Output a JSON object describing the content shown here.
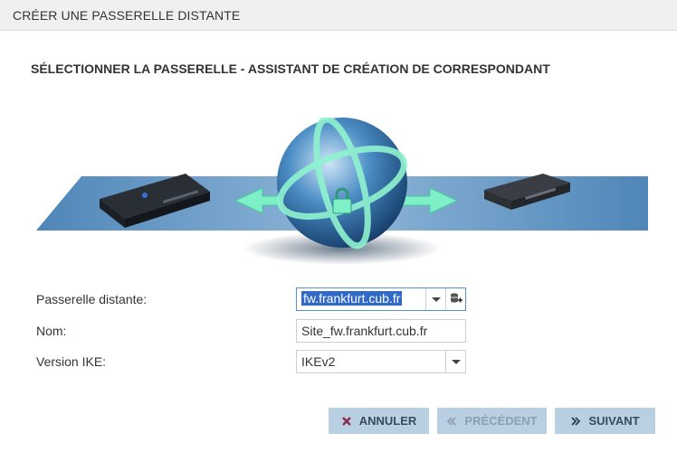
{
  "window": {
    "title": "CRÉER UNE PASSERELLE DISTANTE"
  },
  "wizard": {
    "heading": "SÉLECTIONNER LA PASSERELLE - ASSISTANT DE CRÉATION DE CORRESPONDANT"
  },
  "form": {
    "remote_gateway": {
      "label": "Passerelle distante:",
      "value": "fw.frankfurt.cub.fr"
    },
    "name": {
      "label": "Nom:",
      "value": "Site_fw.frankfurt.cub.fr"
    },
    "ike_version": {
      "label": "Version IKE:",
      "value": "IKEv2"
    }
  },
  "buttons": {
    "cancel": "ANNULER",
    "previous": "PRÉCÉDENT",
    "next": "SUIVANT"
  },
  "icons": {
    "cancel": "close-icon",
    "previous": "double-chevron-left-icon",
    "next": "double-chevron-right-icon",
    "database": "database-add-icon"
  },
  "colors": {
    "button_bg": "#b9cfe2",
    "selection": "#3169c6",
    "cancel_icon": "#8c2a4a"
  }
}
